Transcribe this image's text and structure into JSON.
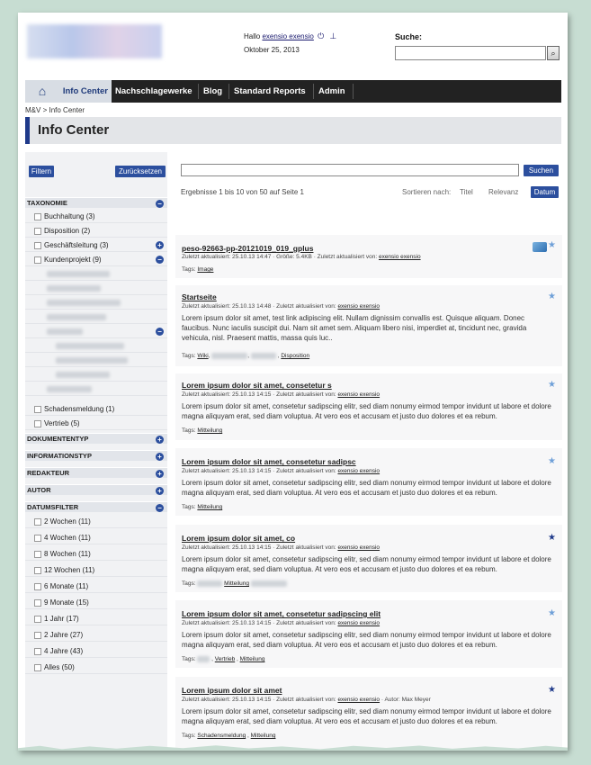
{
  "header": {
    "greeting": "Hallo",
    "username": "exensio exensio",
    "date": "Oktober 25, 2013",
    "search_label": "Suche:",
    "search_placeholder": ""
  },
  "nav": {
    "items": [
      "Info Center",
      "Nachschlagewerke",
      "Blog",
      "Standard Reports",
      "Admin"
    ]
  },
  "breadcrumb": {
    "root": "M&V",
    "sep": ">",
    "current": "Info Center"
  },
  "page_title": "Info Center",
  "sidebar": {
    "filter_label": "Filtern",
    "reset_label": "Zurücksetzen",
    "facets": [
      {
        "label": "TAXONOMIE",
        "state": "expanded"
      },
      {
        "label": "DOKUMENTENTYP",
        "state": "collapsed"
      },
      {
        "label": "INFORMATIONSTYP",
        "state": "collapsed"
      },
      {
        "label": "REDAKTEUR",
        "state": "collapsed"
      },
      {
        "label": "AUTOR",
        "state": "collapsed"
      },
      {
        "label": "DATUMSFILTER",
        "state": "expanded"
      }
    ],
    "taxonomy_items": [
      "Buchhaltung (3)",
      "Disposition (2)",
      "Geschäftsleitung (3)",
      "Kundenprojekt (9)"
    ],
    "taxonomy_items_after": [
      "Schadensmeldung (1)",
      "Vertrieb (5)"
    ],
    "date_items": [
      "2 Wochen (11)",
      "4 Wochen (11)",
      "8 Wochen (11)",
      "12 Wochen (11)",
      "6 Monate (11)",
      "9 Monate (15)",
      "1 Jahr (17)",
      "2 Jahre (27)",
      "4 Jahre (43)",
      "Alles (50)"
    ]
  },
  "main": {
    "search_button": "Suchen",
    "results_text": "Ergebnisse 1 bis 10 von 50 auf Seite 1",
    "sort_label": "Sortieren nach:",
    "sort_options": [
      "Titel",
      "Relevanz",
      "Datum"
    ],
    "sort_selected": "Datum",
    "results": [
      {
        "title": "peso-92663-pp-20121019_019_gplus",
        "meta_prefix": "Zuletzt aktualisiert: 25.10.13 14:47 · Größe: 5.4KB · Zuletzt aktualisiert von:",
        "meta_user": "exensio exensio",
        "body": "",
        "tags_label": "Tags:",
        "tags": [
          "Image"
        ]
      },
      {
        "title": "Startseite",
        "meta_prefix": "Zuletzt aktualisiert: 25.10.13 14:48 · Zuletzt aktualisiert von:",
        "meta_user": "exensio exensio",
        "body": "Lorem ipsum dolor sit amet, test link adipiscing elit. Nullam dignissim convallis est. Quisque aliquam. Donec faucibus. Nunc iaculis suscipit dui. Nam sit amet sem. Aliquam libero nisi, imperdiet at, tincidunt nec, gravida vehicula, nisl. Praesent mattis, massa quis luc..",
        "tags_label": "Tags:",
        "tags": [
          "Wiki",
          "Disposition"
        ]
      },
      {
        "title": "Lorem ipsum dolor sit amet, consetetur s",
        "meta_prefix": "Zuletzt aktualisiert: 25.10.13 14:15 · Zuletzt aktualisiert von:",
        "meta_user": "exensio exensio",
        "body": "Lorem ipsum dolor sit amet, consetetur sadipscing elitr, sed diam nonumy eirmod tempor invidunt ut labore et dolore magna aliquyam erat, sed diam voluptua. At vero eos et accusam et justo duo dolores et ea rebum.",
        "tags_label": "Tags:",
        "tags": [
          "Mitteilung"
        ]
      },
      {
        "title": "Lorem ipsum dolor sit amet, consetetur sadipsc",
        "meta_prefix": "Zuletzt aktualisiert: 25.10.13 14:15 · Zuletzt aktualisiert von:",
        "meta_user": "exensio exensio",
        "body": "Lorem ipsum dolor sit amet, consetetur sadipscing elitr, sed diam nonumy eirmod tempor invidunt ut labore et dolore magna aliquyam erat, sed diam voluptua. At vero eos et accusam et justo duo dolores et ea rebum.",
        "tags_label": "Tags:",
        "tags": [
          "Mitteilung"
        ]
      },
      {
        "title": "Lorem ipsum dolor sit amet, co",
        "meta_prefix": "Zuletzt aktualisiert: 25.10.13 14:15 · Zuletzt aktualisiert von:",
        "meta_user": "exensio exensio",
        "body": "Lorem ipsum dolor sit amet, consetetur sadipscing elitr, sed diam nonumy eirmod tempor invidunt ut labore et dolore magna aliquyam erat, sed diam voluptua. At vero eos et accusam et justo duo dolores et ea rebum.",
        "tags_label": "Tags:",
        "tags": [
          "Mitteilung"
        ]
      },
      {
        "title": "Lorem ipsum dolor sit amet, consetetur sadipscing elit",
        "meta_prefix": "Zuletzt aktualisiert: 25.10.13 14:15 · Zuletzt aktualisiert von:",
        "meta_user": "exensio exensio",
        "body": "Lorem ipsum dolor sit amet, consetetur sadipscing elitr, sed diam nonumy eirmod tempor invidunt ut labore et dolore magna aliquyam erat, sed diam voluptua. At vero eos et accusam et justo duo dolores et ea rebum.",
        "tags_label": "Tags:",
        "tags": [
          "Vertrieb",
          "Mitteilung"
        ]
      },
      {
        "title": "Lorem ipsum dolor sit amet",
        "meta_prefix": "Zuletzt aktualisiert: 25.10.13 14:15 · Zuletzt aktualisiert von:",
        "meta_user": "exensio exensio",
        "meta_suffix": "· Autor: Max Meyer",
        "body": "Lorem ipsum dolor sit amet, consetetur sadipscing elitr, sed diam nonumy eirmod tempor invidunt ut labore et dolore magna aliquyam erat, sed diam voluptua. At vero eos et accusam et justo duo dolores et ea rebum.",
        "tags_label": "Tags:",
        "tags": [
          "Schadensmeldung",
          "Mitteilung"
        ]
      }
    ]
  },
  "icons": [
    "home-icon",
    "logout-icon",
    "user-icon",
    "search-icon",
    "star-icon",
    "file-icon",
    "plus-icon",
    "minus-icon"
  ],
  "colors": {
    "accent": "#2c4f9e",
    "nav_bg": "#222222",
    "page_bg": "#c7ddd2"
  }
}
